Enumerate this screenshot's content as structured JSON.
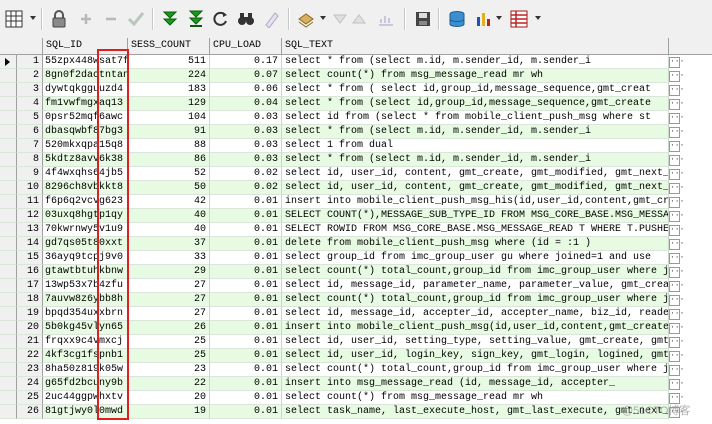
{
  "toolbar": {
    "items": [
      {
        "icon": "grid-layout-icon"
      },
      {
        "icon": "lock-icon"
      },
      {
        "icon": "plus-icon"
      },
      {
        "icon": "minus-icon"
      },
      {
        "icon": "checkmark-icon"
      },
      {
        "icon": "fetch-next-icon"
      },
      {
        "icon": "fetch-all-icon"
      },
      {
        "icon": "refresh-icon"
      },
      {
        "icon": "find-binoculars-icon"
      },
      {
        "icon": "clear-eraser-icon"
      },
      {
        "icon": "export-icon"
      },
      {
        "icon": "navigate-up-icon"
      },
      {
        "icon": "navigate-down-icon"
      },
      {
        "icon": "query-by-example-icon"
      },
      {
        "icon": "save-disk-icon"
      },
      {
        "icon": "database-connect-icon"
      },
      {
        "icon": "bar-chart-icon"
      },
      {
        "icon": "record-view-icon"
      }
    ]
  },
  "grid": {
    "columns": [
      "SQL_ID",
      "SESS_COUNT",
      "CPU_LOAD",
      "SQL_TEXT"
    ],
    "more_glyph": "···",
    "rows": [
      {
        "n": "1",
        "sql_id": "55zpx448wsat7f",
        "sess": "511",
        "cpu": "0.17",
        "sql": "select *  from          (select m.id, m.sender_id, m.sender_i"
      },
      {
        "n": "2",
        "sql_id": "8gn0f2dactntan",
        "sess": "224",
        "cpu": "0.07",
        "sql": "select count(*)        from msg_message_read mr           wh"
      },
      {
        "n": "3",
        "sql_id": "dywtqkgguuzd4",
        "sess": "183",
        "cpu": "0.06",
        "sql": "select * from (   select id,group_id,message_sequence,gmt_creat"
      },
      {
        "n": "4",
        "sql_id": "fm1vwfmgxaq13",
        "sess": "129",
        "cpu": "0.04",
        "sql": "select * from (select   id,group_id,message_sequence,gmt_create"
      },
      {
        "n": "5",
        "sql_id": "0psr52mqf6awc",
        "sess": "104",
        "cpu": "0.03",
        "sql": "select id from (select * from mobile_client_push_msg where   st"
      },
      {
        "n": "6",
        "sql_id": "dbasqwbf87bg3",
        "sess": "91",
        "cpu": "0.03",
        "sql": "select *  from          (select m.id, m.sender_id, m.sender_i"
      },
      {
        "n": "7",
        "sql_id": "520mkxqpa15q8",
        "sess": "88",
        "cpu": "0.03",
        "sql": "select 1 from dual"
      },
      {
        "n": "8",
        "sql_id": "5kdtz8avv6k38",
        "sess": "86",
        "cpu": "0.03",
        "sql": "select *  from          (select m.id, m.sender_id, m.sender_i"
      },
      {
        "n": "9",
        "sql_id": "4f4wxqhs64jb5",
        "sess": "52",
        "cpu": "0.02",
        "sql": "select id, user_id, content, gmt_create, gmt_modified, gmt_next_"
      },
      {
        "n": "10",
        "sql_id": "8296ch8vbkkt8",
        "sess": "50",
        "cpu": "0.02",
        "sql": "select id, user_id, content, gmt_create, gmt_modified, gmt_next_"
      },
      {
        "n": "11",
        "sql_id": "f6p6q2vcvg623",
        "sess": "42",
        "cpu": "0.01",
        "sql": "insert into mobile_client_push_msg_his(id,user_id,content,gmt_cr"
      },
      {
        "n": "12",
        "sql_id": "03uxq8hgtp1qy",
        "sess": "40",
        "cpu": "0.01",
        "sql": "SELECT COUNT(*),MESSAGE_SUB_TYPE_ID FROM MSG_CORE_BASE.MSG_MESSAG"
      },
      {
        "n": "13",
        "sql_id": "70kwrnwy5v1u9",
        "sess": "40",
        "cpu": "0.01",
        "sql": "SELECT ROWID FROM MSG_CORE_BASE.MSG_MESSAGE_READ T WHERE T.PUSHE"
      },
      {
        "n": "14",
        "sql_id": "gd7qs05t80xxt",
        "sess": "37",
        "cpu": "0.01",
        "sql": "delete from mobile_client_push_msg where (id = :1 )"
      },
      {
        "n": "15",
        "sql_id": "36ayq9tcpj9v0",
        "sess": "33",
        "cpu": "0.01",
        "sql": "select group_id from    imc_group_user gu where joined=1 and use"
      },
      {
        "n": "16",
        "sql_id": "gtawtbtuhkbnw",
        "sess": "29",
        "cpu": "0.01",
        "sql": "select count(*) total_count,group_id from imc_group_user where j"
      },
      {
        "n": "17",
        "sql_id": "13wp53x7b4zfu",
        "sess": "27",
        "cpu": "0.01",
        "sql": "select id, message_id, parameter_name, parameter_value, gmt_creat"
      },
      {
        "n": "18",
        "sql_id": "7auvw8z6ybb8h",
        "sess": "27",
        "cpu": "0.01",
        "sql": "select count(*) total_count,group_id from imc_group_user where j"
      },
      {
        "n": "19",
        "sql_id": "bpqd354uxxbrn",
        "sess": "27",
        "cpu": "0.01",
        "sql": "select id, message_id, accepter_id, accepter_name, biz_id, reade"
      },
      {
        "n": "20",
        "sql_id": "5b0kg45vlyn65",
        "sess": "26",
        "cpu": "0.01",
        "sql": "insert into mobile_client_push_msg(id,user_id,content,gmt_create"
      },
      {
        "n": "21",
        "sql_id": "frqxx9c4vmxcj",
        "sess": "25",
        "cpu": "0.01",
        "sql": "select id, user_id, setting_type, setting_value, gmt_create, gmt"
      },
      {
        "n": "22",
        "sql_id": "4kf3cg1fspnb1",
        "sess": "25",
        "cpu": "0.01",
        "sql": "select id, user_id, login_key, sign_key, gmt_login, logined, gmt"
      },
      {
        "n": "23",
        "sql_id": "8ha50z819k05w",
        "sess": "23",
        "cpu": "0.01",
        "sql": "select count(*) total_count,group_id from imc_group_user where j"
      },
      {
        "n": "24",
        "sql_id": "g65fd2bcuny9b",
        "sess": "22",
        "cpu": "0.01",
        "sql": "insert into msg_message_read       (id,        message_id,       accepter_"
      },
      {
        "n": "25",
        "sql_id": "2uc44ggpwhxtv",
        "sess": "20",
        "cpu": "0.01",
        "sql": "select count(*)        from msg_message_read mr           wh"
      },
      {
        "n": "26",
        "sql_id": "81gtjwy0l0mwd",
        "sess": "19",
        "cpu": "0.01",
        "sql": "select task_name, last_execute_host, gmt_last_execute, gmt_next_"
      }
    ]
  },
  "watermark": "@51CTO博客"
}
